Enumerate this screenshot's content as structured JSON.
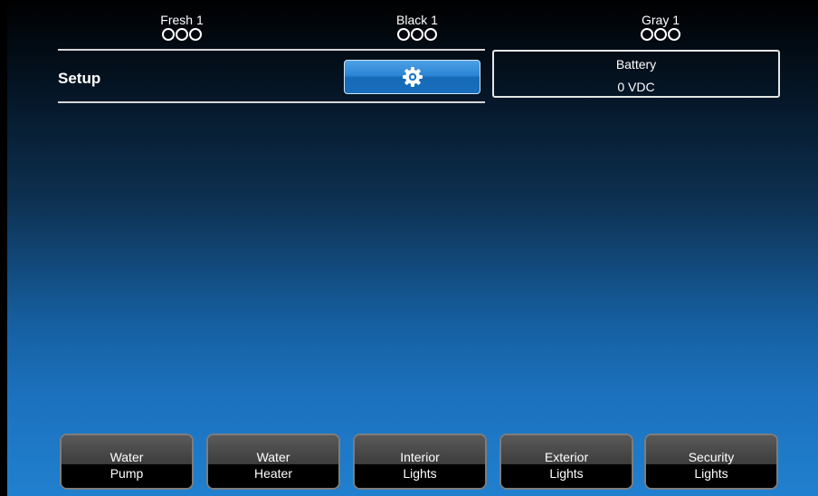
{
  "tanks": [
    {
      "name": "Fresh 1",
      "levels": 3,
      "level_filled": 0
    },
    {
      "name": "Black 1",
      "levels": 3,
      "level_filled": 0
    },
    {
      "name": "Gray 1",
      "levels": 3,
      "level_filled": 0
    }
  ],
  "setup": {
    "label": "Setup",
    "button_icon": "gear-icon"
  },
  "battery": {
    "title": "Battery",
    "value": "0 VDC"
  },
  "controls": [
    {
      "line1": "Water",
      "line2": "Pump"
    },
    {
      "line1": "Water",
      "line2": "Heater"
    },
    {
      "line1": "Interior",
      "line2": "Lights"
    },
    {
      "line1": "Exterior",
      "line2": "Lights"
    },
    {
      "line1": "Security",
      "line2": "Lights"
    }
  ],
  "colors": {
    "accent": "#2a86d6",
    "background_top": "#000000",
    "background_bottom": "#2080cf",
    "text": "#ffffff"
  }
}
